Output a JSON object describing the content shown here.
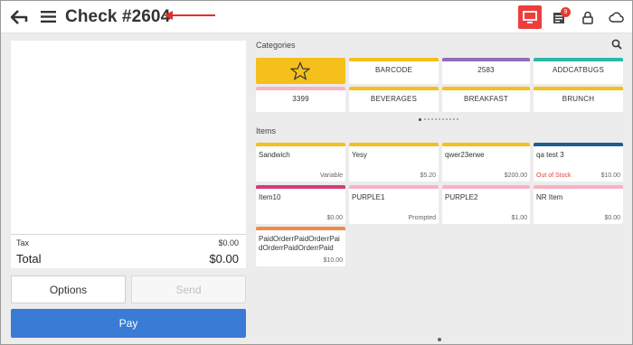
{
  "header": {
    "title": "Check #2604",
    "badge_count": "9",
    "accent_color": "#ee3d3d"
  },
  "check": {
    "tax_label": "Tax",
    "tax_value": "$0.00",
    "total_label": "Total",
    "total_value": "$0.00"
  },
  "actions": {
    "options_label": "Options",
    "send_label": "Send",
    "pay_label": "Pay",
    "pay_color": "#3a7bd5"
  },
  "categories": {
    "heading": "Categories",
    "tiles": [
      {
        "label": "",
        "color": "#f5bf1c",
        "icon": "star-icon"
      },
      {
        "label": "BARCODE",
        "color": "#f5bf1c"
      },
      {
        "label": "2583",
        "color": "#8e6fb8"
      },
      {
        "label": "ADDCATBUGS",
        "color": "#2bb8a6"
      },
      {
        "label": "3399",
        "color": "#f8b3c5"
      },
      {
        "label": "BEVERAGES",
        "color": "#f5bf1c"
      },
      {
        "label": "BREAKFAST",
        "color": "#f5bf1c"
      },
      {
        "label": "BRUNCH",
        "color": "#f5bf1c"
      }
    ]
  },
  "items": {
    "heading": "Items",
    "tiles": [
      {
        "name": "Sandwich",
        "sub": "Variable",
        "status": "",
        "color": "#f5bf1c"
      },
      {
        "name": "Yesy",
        "sub": "$5.20",
        "status": "",
        "color": "#f5bf1c"
      },
      {
        "name": "qwer23erwe",
        "sub": "$200.00",
        "status": "",
        "color": "#f5bf1c"
      },
      {
        "name": "qa test 3",
        "sub": "$10.00",
        "status": "Out of Stock",
        "color": "#1f5e8f"
      },
      {
        "name": "Item10",
        "sub": "$0.00",
        "status": "",
        "color": "#d63b7a"
      },
      {
        "name": "PURPLE1",
        "sub": "Prompted",
        "status": "",
        "color": "#f8b3c5"
      },
      {
        "name": "PURPLE2",
        "sub": "$1.00",
        "status": "",
        "color": "#f8b3c5"
      },
      {
        "name": "NR Item",
        "sub": "$0.00",
        "status": "",
        "color": "#f8b3c5"
      },
      {
        "name": "PaidOrderrPaidOrderrPaidOrderrPaidOrderrPaid",
        "sub": "$10.00",
        "status": "",
        "color": "#f08a4b"
      }
    ]
  }
}
